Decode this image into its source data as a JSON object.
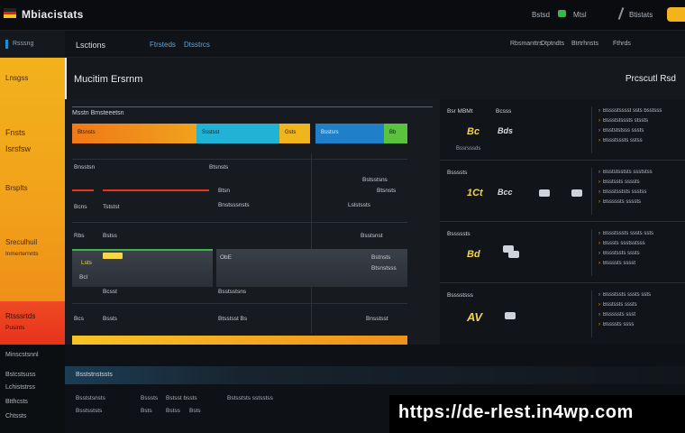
{
  "topbar": {
    "title": "Mbiacistats",
    "item1": "Bstsd",
    "item2": "Mtsl",
    "item3": "Btistats",
    "colors": {
      "accent": "#f2b41a",
      "green": "#3bb54a"
    }
  },
  "subheader": {
    "left_label": "Lsctions",
    "tab1": "Ftrsteds",
    "tab2": "Dtsstrcs",
    "right1": "Rbsmanttrs",
    "right2": "Dtptndts",
    "right3": "Btrtrhnsts",
    "right4": "Fthrds"
  },
  "sidebar": {
    "header": "Rsssng",
    "items": [
      {
        "label": "Lnsgss"
      },
      {
        "label": "Fnsts"
      },
      {
        "label": "Isrsfsw"
      },
      {
        "label": "Brsplts"
      },
      {
        "label": "Sreculhuil"
      },
      {
        "label": "Inmerternnts"
      },
      {
        "label": "Rtsssrtds"
      },
      {
        "label": "Pusints"
      }
    ],
    "lower": [
      "Minscstsnnl",
      "Bstcstsuss",
      "Lchiststrss",
      "Btthcsts",
      "Chtssts"
    ]
  },
  "heading": {
    "title": "Mucitim Ersrnm",
    "right": "Prcscutl Rsd"
  },
  "table": {
    "head": "Msstn Bmsteeetsn",
    "bar": [
      {
        "label": "Btsnsts",
        "color": "#f28a17"
      },
      {
        "label": "Ssstsst",
        "color": "#21b3d6"
      },
      {
        "label": "Gsts",
        "color": "#f0b41d"
      },
      {
        "label": "Bsstsrs",
        "color": "#1f7fc8"
      },
      {
        "label": "Bb",
        "color": "#5ac23c"
      }
    ],
    "row1": {
      "c1": "Bnsstsn",
      "c2": "Btsnsts",
      "c3": "Bstsstsns"
    },
    "row2": {
      "c1": "Btsrh",
      "c2": "Btsn",
      "c3": "Btsnsts"
    },
    "row3": {
      "c1": "Bcns",
      "c2": "Tststst",
      "c3": "Bnstsssnsts",
      "c4": "Lslstssts"
    },
    "row4": {
      "c1": "Rbs",
      "c2": "Bstss",
      "c3": "Bsstsnst"
    },
    "row5": {
      "c1": "Lsts",
      "c2": "ObE",
      "c3": "Bstnsts"
    },
    "row6": {
      "c1": "Bcl",
      "c2": "Btsb",
      "c3": "Btsnstsss"
    },
    "row7": {
      "c1": "Bcsst",
      "c2": "Bsstsstsns"
    },
    "row8": {
      "c1": "Bcs",
      "c2": "Bssts",
      "c3": "Btsstsst Bs",
      "c4": "Bnsstsst"
    }
  },
  "rightcol": {
    "cards": [
      {
        "title": "Bsr MBMt",
        "title2": "Bcsss",
        "big": "Bc",
        "big2": "Bds",
        "sub": "Bssrsssds"
      },
      {
        "title": "Bssssts",
        "big": "1Ct",
        "big2": "Bcc",
        "sub": ""
      },
      {
        "title": "Bsssssts",
        "big": "Bd",
        "big2": "",
        "sub": ""
      },
      {
        "title": "Bsssstsss",
        "big": "AV",
        "big2": "",
        "sub": ""
      }
    ],
    "lists": [
      [
        "Bsssstsssst ssts bsstsss",
        "Bssststsssts stssts",
        "Bsstststsss sssts",
        "Bssstsssts sstss"
      ],
      [
        "Bsststsststs ssststss",
        "Bsstssts ssssts",
        "Bssstsststs ssstss",
        "Bsssssts ssssts"
      ],
      [
        "Bssstsssts sssts ssts",
        "Bsssts ssstsstsss",
        "Bssstssts sssts",
        "Bssssts sssst"
      ],
      [
        "Bssstssts sssts ssts",
        "Bsstssts sssts",
        "Bsssssts ssst",
        "Bssssts ssss"
      ]
    ]
  },
  "bottom": {
    "header": "Bsststnstssts",
    "lines": [
      {
        "a": "Bsststsnsts",
        "b": "Bsssts",
        "c": "Bstsst bssts",
        "d": "Bstsststs sstsstss"
      },
      {
        "a": "Bsstsststs",
        "b": "Bsts",
        "c": "Bstss",
        "d": "Bsts"
      }
    ]
  },
  "watermark": "https://de-rlest.in4wp.com"
}
